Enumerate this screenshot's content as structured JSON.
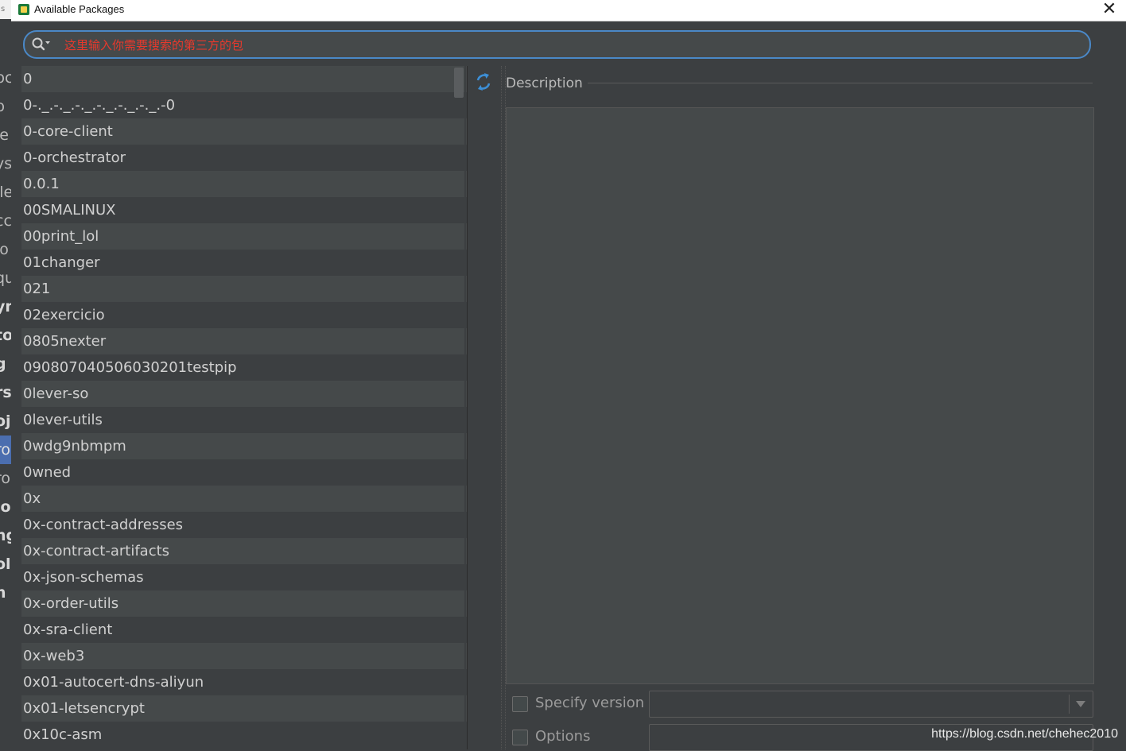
{
  "window": {
    "title": "Available Packages",
    "close_glyph": "✕"
  },
  "search": {
    "placeholder": "这里输入你需要搜索的第三方的包",
    "icon": "search-icon"
  },
  "packages": [
    "0",
    "0-._.-._.-._.-._.-._.-._.-0",
    "0-core-client",
    "0-orchestrator",
    "0.0.1",
    "00SMALINUX",
    "00print_lol",
    "01changer",
    "021",
    "02exercicio",
    "0805nexter",
    "090807040506030201testpip",
    "0lever-so",
    "0lever-utils",
    "0wdg9nbmpm",
    "0wned",
    "0x",
    "0x-contract-addresses",
    "0x-contract-artifacts",
    "0x-json-schemas",
    "0x-order-utils",
    "0x-sra-client",
    "0x-web3",
    "0x01-autocert-dns-aliyun",
    "0x01-letsencrypt",
    "0x10c-asm"
  ],
  "toolbar": {
    "reload_icon": "reload-icon"
  },
  "description": {
    "title": "Description",
    "text": ""
  },
  "options": {
    "specify_version_label": "Specify version",
    "specify_version_value": "",
    "options_label": "Options",
    "options_value": ""
  },
  "background": {
    "left_labels": [
      "pc",
      "p",
      "le",
      "ys",
      "ile",
      "cc",
      "io",
      "qu",
      "yn",
      "to",
      "g",
      "rsi",
      "oje",
      "ro",
      "ro",
      "lo",
      "ng",
      "ols",
      "n"
    ]
  },
  "watermark": "https://blog.csdn.net/chehec2010",
  "colors": {
    "accent": "#4a88c7",
    "placeholder": "#e8392c",
    "background": "#3c3f41",
    "row_alt": "#45494a"
  }
}
